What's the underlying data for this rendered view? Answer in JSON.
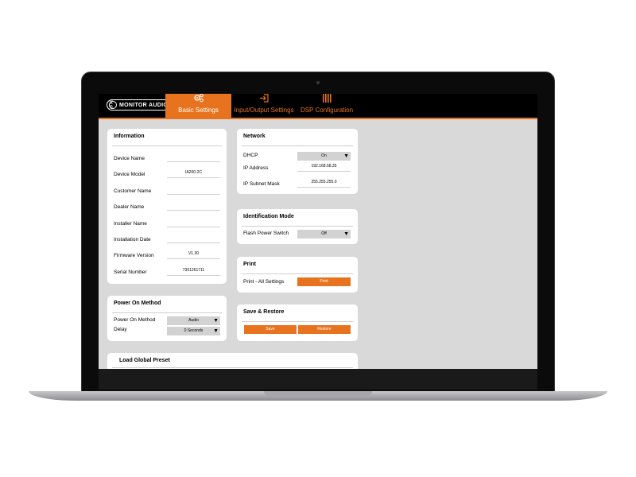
{
  "brand": {
    "logo_mark": "(( ))",
    "logo_text": "MONITOR AUDIO"
  },
  "tabs": [
    {
      "label": "Basic Settings",
      "icon": "gear-icon",
      "active": true
    },
    {
      "label": "Input/Output Settings",
      "icon": "login-icon",
      "active": false
    },
    {
      "label": "DSP Configuration",
      "icon": "equalizer-icon",
      "active": false
    }
  ],
  "information": {
    "title": "Information",
    "rows": [
      {
        "label": "Device Name",
        "value": ""
      },
      {
        "label": "Device Model",
        "value": "IA200-2C"
      },
      {
        "label": "Customer Name",
        "value": ""
      },
      {
        "label": "Dealer Name",
        "value": ""
      },
      {
        "label": "Installer Name",
        "value": ""
      },
      {
        "label": "Installation Date",
        "value": ""
      },
      {
        "label": "Firmware Version",
        "value": "V1.30"
      },
      {
        "label": "Serial Number",
        "value": "7301261711"
      }
    ]
  },
  "power_on": {
    "title": "Power On Method",
    "method_label": "Power On Method",
    "method_value": "Audio",
    "delay_label": "Delay",
    "delay_value": "0 Seconds"
  },
  "network": {
    "title": "Network",
    "dhcp_label": "DHCP",
    "dhcp_value": "On",
    "ip_label": "IP Address",
    "ip_value": "192.168.68.35",
    "mask_label": "IP Subnet Mask",
    "mask_value": "255.255.255.0"
  },
  "identification": {
    "title": "Identification Mode",
    "flash_label": "Flash Power Switch",
    "flash_value": "Off"
  },
  "print": {
    "title": "Print",
    "all_label": "Print - All Settings",
    "button": "Print"
  },
  "save_restore": {
    "title": "Save & Restore",
    "save_button": "Save",
    "restore_button": "Restore"
  },
  "global_preset": {
    "title": "Load Global Preset"
  },
  "colors": {
    "accent": "#e8731e",
    "content_bg": "#d9d9d9",
    "header_bg": "#000000"
  }
}
